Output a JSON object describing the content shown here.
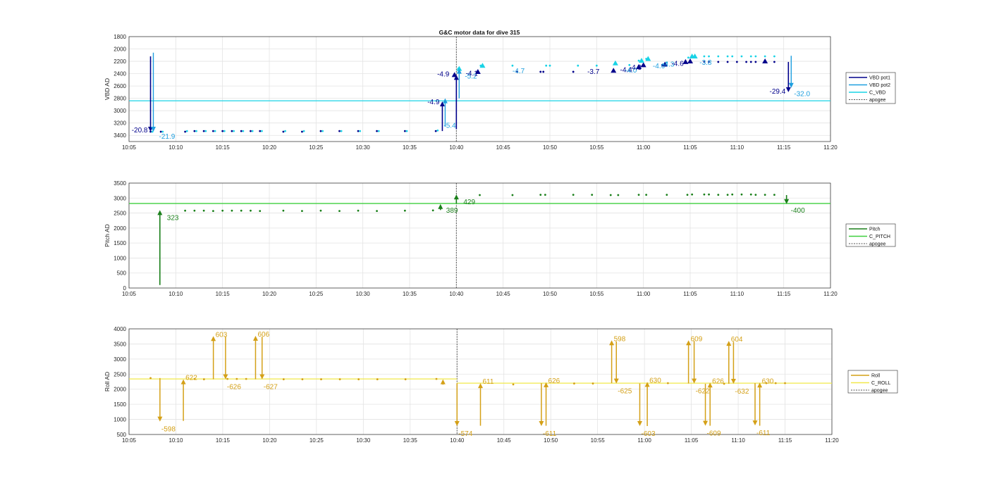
{
  "figure_title": "G&C motor data for dive 315",
  "colors": {
    "vbd_pot1": "#00008b",
    "vbd_pot2": "#1e9fdf",
    "c_vbd": "#19d3e6",
    "pitch": "#1a7f1a",
    "c_pitch": "#3fcf3f",
    "roll": "#d4a017",
    "c_roll": "#f2e84a",
    "apogee": "#555555"
  },
  "chart_data": [
    {
      "type": "scatter",
      "name": "vbd",
      "ylabel": "VBD AD",
      "reverse_y": true,
      "xlim": [
        "10:05",
        "11:20"
      ],
      "ylim": [
        1800,
        3500
      ],
      "xticks": [
        "10:05",
        "10:10",
        "10:15",
        "10:20",
        "10:25",
        "10:30",
        "10:35",
        "10:40",
        "10:45",
        "10:50",
        "10:55",
        "11:00",
        "11:05",
        "11:10",
        "11:15",
        "11:20"
      ],
      "yticks": [
        "1800",
        "2000",
        "2200",
        "2400",
        "2600",
        "2800",
        "3000",
        "3200",
        "3400"
      ],
      "grid": true,
      "legend": [
        "VBD pot1",
        "VBD pot2",
        "C_VBD",
        "apogee"
      ],
      "legend_position": "right",
      "apogee_x": "10:40",
      "reference_line": {
        "name": "C_VBD",
        "y": 2840
      },
      "pot1_points": [
        [
          "10:07.3",
          3340
        ],
        [
          "10:08.4",
          3340
        ],
        [
          "10:11",
          3340
        ],
        [
          "10:12",
          3330
        ],
        [
          "10:13",
          3330
        ],
        [
          "10:14",
          3330
        ],
        [
          "10:15",
          3330
        ],
        [
          "10:16",
          3330
        ],
        [
          "10:17",
          3330
        ],
        [
          "10:18",
          3330
        ],
        [
          "10:19",
          3330
        ],
        [
          "10:21.5",
          3340
        ],
        [
          "10:23.5",
          3340
        ],
        [
          "10:25.5",
          3330
        ],
        [
          "10:27.5",
          3330
        ],
        [
          "10:29.5",
          3330
        ],
        [
          "10:31.5",
          3330
        ],
        [
          "10:34.5",
          3330
        ],
        [
          "10:37.8",
          3330
        ],
        [
          "10:39.8",
          2420
        ],
        [
          "10:42.3",
          2370
        ],
        [
          "10:46.5",
          2370
        ],
        [
          "10:49",
          2370
        ],
        [
          "10:49.3",
          2370
        ],
        [
          "10:52.5",
          2370
        ],
        [
          "10:56.8",
          2350
        ],
        [
          "10:59.5",
          2290
        ],
        [
          "11:00",
          2260
        ],
        [
          "11:02",
          2260
        ],
        [
          "11:04.5",
          2210
        ],
        [
          "11:05",
          2210
        ],
        [
          "11:06.5",
          2210
        ],
        [
          "11:07",
          2210
        ],
        [
          "11:08",
          2210
        ],
        [
          "11:09",
          2210
        ],
        [
          "11:10",
          2210
        ],
        [
          "11:11",
          2210
        ],
        [
          "11:11.5",
          2210
        ],
        [
          "11:12",
          2210
        ],
        [
          "11:13",
          2210
        ],
        [
          "11:14",
          2210
        ]
      ],
      "pot2_points": [
        [
          "10:07.5",
          3340
        ],
        [
          "10:08.6",
          3340
        ],
        [
          "10:11.2",
          3330
        ],
        [
          "10:12.2",
          3330
        ],
        [
          "10:13.2",
          3330
        ],
        [
          "10:14.2",
          3330
        ],
        [
          "10:15.2",
          3330
        ],
        [
          "10:16.2",
          3330
        ],
        [
          "10:17.2",
          3330
        ],
        [
          "10:18.2",
          3330
        ],
        [
          "10:19.2",
          3330
        ],
        [
          "10:21.7",
          3330
        ],
        [
          "10:23.7",
          3330
        ],
        [
          "10:25.7",
          3330
        ],
        [
          "10:27.7",
          3330
        ],
        [
          "10:29.7",
          3330
        ],
        [
          "10:31.7",
          3330
        ],
        [
          "10:34.7",
          3330
        ],
        [
          "10:38",
          3320
        ],
        [
          "10:40.2",
          2320
        ],
        [
          "10:42.6",
          2270
        ],
        [
          "10:46",
          2270
        ],
        [
          "10:49.6",
          2270
        ],
        [
          "10:50",
          2270
        ],
        [
          "10:53",
          2270
        ],
        [
          "10:55",
          2270
        ],
        [
          "10:57",
          2230
        ],
        [
          "10:58.5",
          2260
        ],
        [
          "10:59.5",
          2190
        ],
        [
          "11:00.3",
          2160
        ],
        [
          "11:02.5",
          2220
        ],
        [
          "11:04.8",
          2140
        ],
        [
          "11:05.2",
          2120
        ],
        [
          "11:06.5",
          2120
        ],
        [
          "11:07",
          2120
        ],
        [
          "11:08",
          2120
        ],
        [
          "11:09",
          2120
        ],
        [
          "11:09.5",
          2120
        ],
        [
          "11:10.5",
          2120
        ],
        [
          "11:11.5",
          2120
        ],
        [
          "11:12",
          2120
        ],
        [
          "11:13",
          2120
        ],
        [
          "11:14",
          2120
        ]
      ],
      "pot1_moves": [
        {
          "t": "10:07.3",
          "from": 2120,
          "to": 3340,
          "label": "-20.8"
        },
        {
          "t": "10:38.5",
          "from": 3330,
          "to": 2850,
          "label": "-4.9"
        },
        {
          "t": "10:40",
          "from": 3300,
          "to": 2420,
          "label": "-4.9"
        },
        {
          "t": "11:15.5",
          "from": 2210,
          "to": 2700,
          "label": "-29.4"
        }
      ],
      "pot2_moves": [
        {
          "t": "10:07.6",
          "from": 2060,
          "to": 3340,
          "label": "-21.9"
        },
        {
          "t": "10:38.8",
          "from": 3260,
          "to": 2800,
          "label": "-5.4"
        },
        {
          "t": "10:40.3",
          "from": 2800,
          "to": 2320,
          "label": "-5.2"
        },
        {
          "t": "11:15.8",
          "from": 2110,
          "to": 2630,
          "label": "-32.0"
        }
      ],
      "labels": [
        {
          "t": "10:41",
          "y": 2400,
          "text": "-4.1",
          "series": "pot1"
        },
        {
          "t": "10:46",
          "y": 2360,
          "text": "-4.7",
          "series": "pot2"
        },
        {
          "t": "10:54",
          "y": 2370,
          "text": "-3.7",
          "series": "pot1"
        },
        {
          "t": "10:57.5",
          "y": 2340,
          "text": "-4.4",
          "series": "pot1"
        },
        {
          "t": "10:58",
          "y": 2350,
          "text": "-4.0",
          "series": "pot2"
        },
        {
          "t": "10:58.5",
          "y": 2300,
          "text": "-4.3",
          "series": "pot1"
        },
        {
          "t": "11:01",
          "y": 2280,
          "text": "-4.6",
          "series": "pot2"
        },
        {
          "t": "11:02",
          "y": 2250,
          "text": "-4.3",
          "series": "pot2"
        },
        {
          "t": "11:03",
          "y": 2240,
          "text": "-4.6",
          "series": "pot1"
        },
        {
          "t": "11:06",
          "y": 2220,
          "text": "-3.8",
          "series": "pot2"
        }
      ],
      "triangles_pot1": [
        [
          "10:39.8",
          2420
        ],
        [
          "10:42.3",
          2370
        ],
        [
          "10:56.8",
          2350
        ],
        [
          "10:59.5",
          2290
        ],
        [
          "11:00",
          2260
        ],
        [
          "11:02.3",
          2250
        ],
        [
          "11:04.5",
          2210
        ],
        [
          "11:05",
          2200
        ],
        [
          "11:13",
          2200
        ]
      ],
      "triangles_pot2": [
        [
          "10:40.3",
          2320
        ],
        [
          "10:42.8",
          2270
        ],
        [
          "10:57",
          2230
        ],
        [
          "10:59.8",
          2190
        ],
        [
          "11:00.5",
          2160
        ],
        [
          "11:05.2",
          2120
        ],
        [
          "11:05.5",
          2120
        ]
      ]
    },
    {
      "type": "scatter",
      "name": "pitch",
      "ylabel": "Pitch AD",
      "xlim": [
        "10:05",
        "11:20"
      ],
      "ylim": [
        0,
        3500
      ],
      "xticks": [
        "10:05",
        "10:10",
        "10:15",
        "10:20",
        "10:25",
        "10:30",
        "10:35",
        "10:40",
        "10:45",
        "10:50",
        "10:55",
        "11:00",
        "11:05",
        "11:10",
        "11:15",
        "11:20"
      ],
      "yticks": [
        "0",
        "500",
        "1000",
        "1500",
        "2000",
        "2500",
        "3000",
        "3500"
      ],
      "grid": true,
      "legend": [
        "Pitch",
        "C_PITCH",
        "apogee"
      ],
      "legend_position": "right",
      "apogee_x": "10:40",
      "reference_line": {
        "name": "C_PITCH",
        "y": 2820
      },
      "points": [
        [
          "10:11",
          2580
        ],
        [
          "10:12",
          2580
        ],
        [
          "10:13",
          2580
        ],
        [
          "10:14",
          2570
        ],
        [
          "10:15",
          2580
        ],
        [
          "10:16",
          2580
        ],
        [
          "10:17",
          2580
        ],
        [
          "10:18",
          2580
        ],
        [
          "10:19",
          2570
        ],
        [
          "10:21.5",
          2580
        ],
        [
          "10:23.5",
          2570
        ],
        [
          "10:25.5",
          2580
        ],
        [
          "10:27.5",
          2570
        ],
        [
          "10:29.5",
          2580
        ],
        [
          "10:31.5",
          2570
        ],
        [
          "10:34.5",
          2580
        ],
        [
          "10:37.5",
          2590
        ],
        [
          "10:42.5",
          3100
        ],
        [
          "10:46",
          3100
        ],
        [
          "10:49",
          3110
        ],
        [
          "10:49.5",
          3110
        ],
        [
          "10:52.5",
          3110
        ],
        [
          "10:54.5",
          3110
        ],
        [
          "10:56.5",
          3100
        ],
        [
          "10:57.3",
          3100
        ],
        [
          "10:59.5",
          3110
        ],
        [
          "11:00.3",
          3110
        ],
        [
          "11:02.5",
          3110
        ],
        [
          "11:04.7",
          3110
        ],
        [
          "11:05.2",
          3120
        ],
        [
          "11:06.5",
          3120
        ],
        [
          "11:07",
          3120
        ],
        [
          "11:08",
          3110
        ],
        [
          "11:09",
          3110
        ],
        [
          "11:09.5",
          3120
        ],
        [
          "11:10.5",
          3120
        ],
        [
          "11:11.5",
          3120
        ],
        [
          "11:12",
          3110
        ],
        [
          "11:13",
          3110
        ],
        [
          "11:14",
          3110
        ]
      ],
      "moves": [
        {
          "t": "10:08.3",
          "from": 100,
          "to": 2600,
          "label": "323"
        },
        {
          "t": "10:38.3",
          "from": 2600,
          "to": 2800,
          "label": "389"
        },
        {
          "t": "10:40",
          "from": 2820,
          "to": 3120,
          "label": "429"
        },
        {
          "t": "11:15.3",
          "from": 3100,
          "to": 2800,
          "label": "-400"
        }
      ]
    },
    {
      "type": "scatter",
      "name": "roll",
      "ylabel": "Roll AD",
      "xlim": [
        "10:05",
        "11:20"
      ],
      "ylim": [
        500,
        4000
      ],
      "xticks": [
        "10:05",
        "10:10",
        "10:15",
        "10:20",
        "10:25",
        "10:30",
        "10:35",
        "10:40",
        "10:45",
        "10:50",
        "10:55",
        "11:00",
        "11:05",
        "11:10",
        "11:15",
        "11:20"
      ],
      "yticks": [
        "500",
        "1000",
        "1500",
        "2000",
        "2500",
        "3000",
        "3500",
        "4000"
      ],
      "grid": true,
      "legend": [
        "Roll",
        "C_ROLL",
        "apogee"
      ],
      "legend_position": "right",
      "apogee_x": "10:40",
      "reference_line_left": {
        "name": "C_ROLL",
        "y": 2340,
        "until": "10:40"
      },
      "reference_line_right": {
        "name": "C_ROLL",
        "y": 2200,
        "from": "10:40"
      },
      "points": [
        [
          "10:07.3",
          2370
        ],
        [
          "10:12",
          2340
        ],
        [
          "10:13",
          2330
        ],
        [
          "10:15.5",
          2340
        ],
        [
          "10:16.5",
          2340
        ],
        [
          "10:17.5",
          2340
        ],
        [
          "10:21.5",
          2330
        ],
        [
          "10:23.5",
          2330
        ],
        [
          "10:25.5",
          2330
        ],
        [
          "10:27.5",
          2330
        ],
        [
          "10:29.5",
          2330
        ],
        [
          "10:31.5",
          2330
        ],
        [
          "10:34.5",
          2330
        ],
        [
          "10:37.8",
          2340
        ],
        [
          "10:46",
          2160
        ],
        [
          "10:52.5",
          2190
        ],
        [
          "10:54.5",
          2190
        ],
        [
          "11:02.5",
          2200
        ],
        [
          "11:08.5",
          2180
        ],
        [
          "11:13",
          2200
        ],
        [
          "11:14",
          2200
        ],
        [
          "11:15",
          2200
        ]
      ],
      "moves": [
        {
          "t": "10:08.3",
          "from": 2370,
          "to": 930,
          "label": "-598",
          "dir": "down"
        },
        {
          "t": "10:10.8",
          "from": 950,
          "to": 2330,
          "label": "622",
          "dir": "up"
        },
        {
          "t": "10:14",
          "from": 2330,
          "to": 3760,
          "label": "603",
          "dir": "up"
        },
        {
          "t": "10:15.3",
          "from": 3740,
          "to": 2330,
          "label": "-626",
          "dir": "down"
        },
        {
          "t": "10:18.5",
          "from": 2330,
          "to": 3770,
          "label": "606",
          "dir": "up"
        },
        {
          "t": "10:19.2",
          "from": 3740,
          "to": 2330,
          "label": "-627",
          "dir": "down"
        },
        {
          "t": "10:38.5",
          "from": 2150,
          "to": 2330,
          "label": "",
          "dir": "up"
        },
        {
          "t": "10:40",
          "from": 2200,
          "to": 780,
          "label": "-574",
          "dir": "down"
        },
        {
          "t": "10:42.5",
          "from": 790,
          "to": 2200,
          "label": "611",
          "dir": "up"
        },
        {
          "t": "10:49",
          "from": 2200,
          "to": 780,
          "label": "-611",
          "dir": "down"
        },
        {
          "t": "10:49.5",
          "from": 790,
          "to": 2230,
          "label": "626",
          "dir": "up"
        },
        {
          "t": "10:56.5",
          "from": 2200,
          "to": 3620,
          "label": "598",
          "dir": "up"
        },
        {
          "t": "10:57",
          "from": 3580,
          "to": 2190,
          "label": "-625",
          "dir": "down"
        },
        {
          "t": "10:59.5",
          "from": 2190,
          "to": 780,
          "label": "-603",
          "dir": "down"
        },
        {
          "t": "11:00.3",
          "from": 780,
          "to": 2240,
          "label": "630",
          "dir": "up"
        },
        {
          "t": "11:04.7",
          "from": 2190,
          "to": 3620,
          "label": "609",
          "dir": "up"
        },
        {
          "t": "11:05.3",
          "from": 3600,
          "to": 2190,
          "label": "-622",
          "dir": "down"
        },
        {
          "t": "11:06.5",
          "from": 2180,
          "to": 790,
          "label": "-609",
          "dir": "down"
        },
        {
          "t": "11:07",
          "from": 790,
          "to": 2220,
          "label": "626",
          "dir": "up"
        },
        {
          "t": "11:09",
          "from": 2180,
          "to": 3600,
          "label": "604",
          "dir": "up"
        },
        {
          "t": "11:09.5",
          "from": 3570,
          "to": 2180,
          "label": "-632",
          "dir": "down"
        },
        {
          "t": "11:11.8",
          "from": 2200,
          "to": 800,
          "label": "-611",
          "dir": "down"
        },
        {
          "t": "11:12.3",
          "from": 790,
          "to": 2220,
          "label": "630",
          "dir": "up"
        }
      ]
    }
  ]
}
